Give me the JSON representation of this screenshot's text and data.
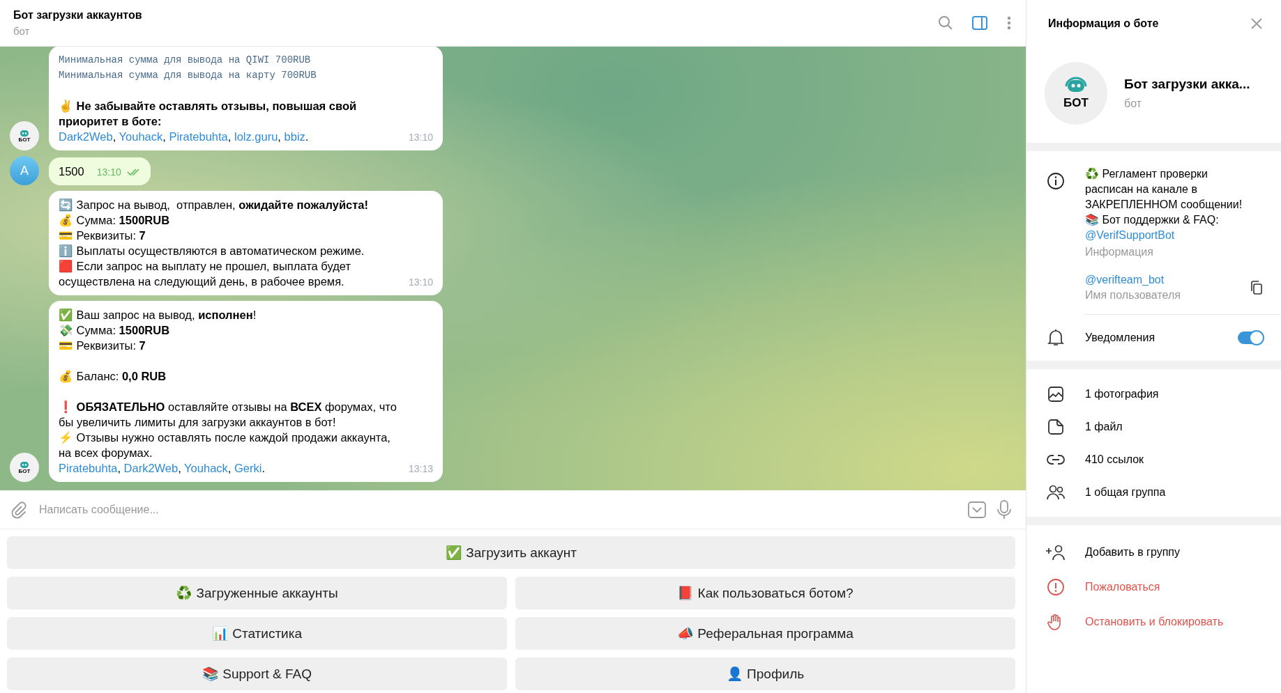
{
  "chat_header": {
    "title": "Бот загрузки аккаунтов",
    "subtitle": "бот",
    "side_panel_open": true
  },
  "messages": [
    {
      "kind": "incoming",
      "avatar": true,
      "avatar_text": "БОТ",
      "time": "13:10",
      "paragraphs": [
        {
          "kind": "mono",
          "lines": [
            "Минимальная сумма для вывода на QIWI 700RUB",
            "Минимальная сумма для вывода на карту 700RUB"
          ]
        },
        {
          "kind": "text",
          "lines": [
            "✌ **Не забывайте оставлять отзывы, повышая свой приоритет в боте:**"
          ],
          "links": [
            {
              "text": "Dark2Web",
              "kind": "link"
            },
            {
              "text": ", ",
              "kind": "plain"
            },
            {
              "text": "Youhack",
              "kind": "link"
            },
            {
              "text": ", ",
              "kind": "plain"
            },
            {
              "text": "Piratebuhta",
              "kind": "link"
            },
            {
              "text": ", ",
              "kind": "plain"
            },
            {
              "text": "lolz.guru",
              "kind": "link"
            },
            {
              "text": ", ",
              "kind": "plain"
            },
            {
              "text": "bbiz",
              "kind": "link"
            },
            {
              "text": ".",
              "kind": "plain"
            }
          ]
        }
      ]
    },
    {
      "kind": "outgoing",
      "avatar": true,
      "avatar_text": "A",
      "time": "13:10",
      "read": true,
      "paragraphs": [
        {
          "kind": "text",
          "lines": [
            "1500"
          ]
        }
      ]
    },
    {
      "kind": "incoming",
      "avatar": false,
      "time": "13:10",
      "paragraphs": [
        {
          "kind": "text",
          "lines": [
            "🔄 Запрос на вывод,  отправлен, **ожидайте пожалуйста!**",
            "💰 Сумма: **1500RUB**",
            "💳 Реквизиты: **7**",
            "ℹ️ Выплаты осуществляются в автоматическом режиме.",
            "🟥 Если запрос на выплату не прошел, выплата будет осуществлена на следующий день, в рабочее время."
          ]
        }
      ]
    },
    {
      "kind": "incoming",
      "avatar": true,
      "avatar_text": "БОТ",
      "time": "13:13",
      "paragraphs": [
        {
          "kind": "text",
          "lines": [
            "✅ Ваш запрос на вывод, **исполнен**!",
            "💸 Сумма: **1500RUB**",
            "💳 Реквизиты: **7**"
          ]
        },
        {
          "kind": "text",
          "lines": [
            "💰 Баланс: **0,0 RUB**"
          ]
        },
        {
          "kind": "text",
          "lines": [
            "❗ **ОБЯЗАТЕЛЬНО** оставляйте отзывы на **ВСЕХ** форумах, что бы увеличить лимиты для загрузки аккаунтов в бот!",
            "⚡ Отзывы нужно оставлять после каждой продажи аккаунта, на всех форумах."
          ],
          "links": [
            {
              "text": "Piratebuhta",
              "kind": "link"
            },
            {
              "text": ", ",
              "kind": "plain"
            },
            {
              "text": "Dark2Web",
              "kind": "link"
            },
            {
              "text": ", ",
              "kind": "plain"
            },
            {
              "text": "Youhack",
              "kind": "link"
            },
            {
              "text": ", ",
              "kind": "plain"
            },
            {
              "text": "Gerki",
              "kind": "link"
            },
            {
              "text": ".",
              "kind": "plain"
            }
          ]
        }
      ]
    }
  ],
  "composer": {
    "placeholder": "Написать сообщение..."
  },
  "keyboard": {
    "rows": [
      [
        "✅ Загрузить аккаунт"
      ],
      [
        "♻️ Загруженные аккаунты",
        "📕 Как пользоваться ботом?"
      ],
      [
        "📊 Статистика",
        "📣 Реферальная программа"
      ],
      [
        "📚 Support & FAQ",
        "👤 Профиль"
      ]
    ]
  },
  "info_panel": {
    "title": "Информация о боте",
    "avatar_text": "БОТ",
    "name": "Бот загрузки акка...",
    "subtitle": "бот",
    "bio": {
      "text": "♻️ Регламент проверки расписан на канале в ЗАКРЕПЛЕННОМ сообщении!\n📚 Бот поддержки & FAQ:",
      "link": "@VerifSupportBot",
      "caption": "Информация"
    },
    "username": {
      "value": "@verifteam_bot",
      "caption": "Имя пользователя"
    },
    "notifications": {
      "label": "Уведомления",
      "on": true
    },
    "media": [
      {
        "kind": "photo",
        "label": "1 фотография"
      },
      {
        "kind": "file",
        "label": "1 файл"
      },
      {
        "kind": "link",
        "label": "410 ссылок"
      },
      {
        "kind": "group",
        "label": "1 общая группа"
      }
    ],
    "actions": [
      {
        "kind": "add",
        "label": "Добавить в группу"
      },
      {
        "kind": "report",
        "label": "Пожаловаться"
      },
      {
        "kind": "block",
        "label": "Остановить и блокировать"
      }
    ]
  }
}
